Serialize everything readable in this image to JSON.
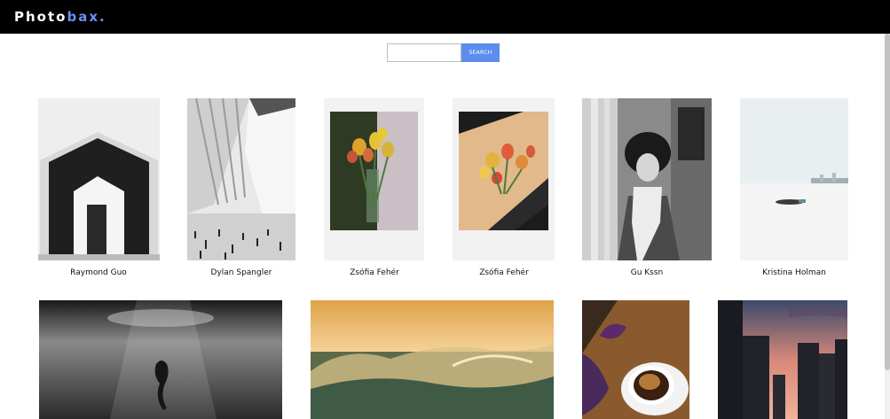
{
  "app": {
    "logo_main": "Photo",
    "logo_accent": "bax."
  },
  "search": {
    "placeholder": "",
    "value": "",
    "button_label": "SEARCH"
  },
  "gallery": {
    "row1": [
      {
        "photographer": "Raymond Guo",
        "subject": "white barn facade"
      },
      {
        "photographer": "Dylan Spangler",
        "subject": "station hall with ribs"
      },
      {
        "photographer": "Zsófia Fehér",
        "subject": "tulips polaroid"
      },
      {
        "photographer": "Zsófia Fehér",
        "subject": "tulips on table polaroid"
      },
      {
        "photographer": "Gu Kssn",
        "subject": "woman in scarf"
      },
      {
        "photographer": "Kristina Holman",
        "subject": "beach in snow"
      }
    ],
    "row2": [
      {
        "subject": "underwater diver"
      },
      {
        "subject": "ocean waves at sunset"
      },
      {
        "subject": "coffee cup on table"
      },
      {
        "subject": "city skyline at dusk"
      }
    ]
  },
  "colors": {
    "header_bg": "#000000",
    "logo_accent": "#6f8df5",
    "search_button": "#5b8def"
  }
}
